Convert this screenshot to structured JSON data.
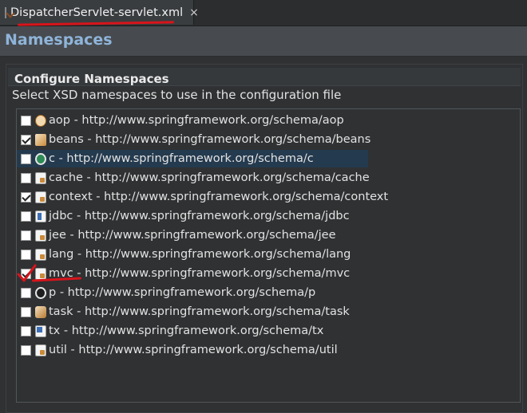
{
  "tab": {
    "label": "DispatcherServlet-servlet.xml",
    "close": "×"
  },
  "header": {
    "title": "Namespaces"
  },
  "section": {
    "title": "Configure Namespaces",
    "description": "Select XSD namespaces to use in the configuration file"
  },
  "namespaces": [
    {
      "label": "aop - http://www.springframework.org/schema/aop",
      "checked": false,
      "icon": "aop-icon"
    },
    {
      "label": "beans - http://www.springframework.org/schema/beans",
      "checked": true,
      "icon": "bean-icon"
    },
    {
      "label": "c - http://www.springframework.org/schema/c",
      "checked": false,
      "icon": "c-icon",
      "selected": true
    },
    {
      "label": "cache - http://www.springframework.org/schema/cache",
      "checked": false,
      "icon": "cache-icon"
    },
    {
      "label": "context - http://www.springframework.org/schema/context",
      "checked": true,
      "icon": "context-icon"
    },
    {
      "label": "jdbc - http://www.springframework.org/schema/jdbc",
      "checked": false,
      "icon": "jdbc-icon"
    },
    {
      "label": "jee - http://www.springframework.org/schema/jee",
      "checked": false,
      "icon": "jee-icon"
    },
    {
      "label": "lang - http://www.springframework.org/schema/lang",
      "checked": false,
      "icon": "lang-icon"
    },
    {
      "label": "mvc - http://www.springframework.org/schema/mvc",
      "checked": true,
      "icon": "mvc-icon"
    },
    {
      "label": "p - http://www.springframework.org/schema/p",
      "checked": false,
      "icon": "p-icon"
    },
    {
      "label": "task - http://www.springframework.org/schema/task",
      "checked": false,
      "icon": "task-icon"
    },
    {
      "label": "tx - http://www.springframework.org/schema/tx",
      "checked": false,
      "icon": "tx-icon"
    },
    {
      "label": "util - http://www.springframework.org/schema/util",
      "checked": false,
      "icon": "util-icon"
    }
  ],
  "colors": {
    "header_title": "#8fb4d9",
    "annotation": "#d8141b",
    "selection": "#243a4e"
  }
}
